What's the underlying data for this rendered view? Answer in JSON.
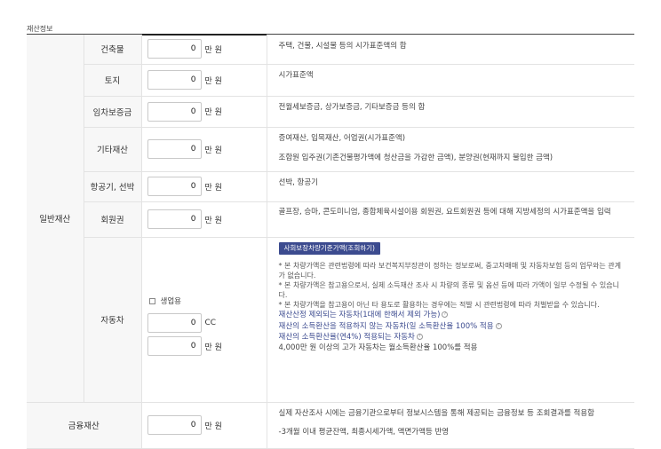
{
  "section_title": "재산정보",
  "category_general": "일반재산",
  "rows": [
    {
      "label": "건축물",
      "value": "0",
      "unit": "만 원",
      "desc": [
        "주택, 건물, 시설물 등의 시가표준액의 합"
      ]
    },
    {
      "label": "토지",
      "value": "0",
      "unit": "만 원",
      "desc": [
        "시가표준액"
      ]
    },
    {
      "label": "임차보증금",
      "value": "0",
      "unit": "만 원",
      "desc": [
        "전월세보증금, 상가보증금, 기타보증금 등의 합"
      ]
    },
    {
      "label": "기타재산",
      "value": "0",
      "unit": "만 원",
      "desc": [
        "증여재산, 입목재산, 어업권(시가표준액)",
        "조합원 입주권(기존건물평가액에 청산금을 가감한 금액), 분양권(현재까지 불입한 금액)"
      ]
    },
    {
      "label": "항공기, 선박",
      "value": "0",
      "unit": "만 원",
      "desc": [
        "선박, 항공기"
      ]
    },
    {
      "label": "회원권",
      "value": "0",
      "unit": "만 원",
      "desc": [
        "골프장, 승마, 콘도미니엄, 종합체육시설이용 회원권, 요트회원권 등에 대해 지방세정의 시가표준액을 입력"
      ]
    }
  ],
  "car": {
    "label": "자동차",
    "checkbox_label": "생업용",
    "cc_value": "0",
    "cc_unit": "CC",
    "price_value": "0",
    "price_unit": "만 원",
    "lookup_button": "사회보장차량기준가액(조회하기)",
    "notes": [
      "* 본 차량가액은 관련법령에 따라 보건복지부장관이 정하는 정보로써, 중고차매매 및 자동차보험 등의 업무와는 관계가 없습니다.",
      "* 본 차량가액은 참고용으로서, 실제 소득재산 조사 시 차량의 종류 및 옵션 등에 따라 가액이 일부 수정될 수 있습니다.",
      "* 본 차량가액을 참고용이 아닌 타 용도로 활용하는 경우에는 적발 시 관련법령에 따라 처벌받을 수 있습니다."
    ],
    "links": [
      "재산산정 제외되는 자동차(1대에 한해서 제외 가능)",
      "재산의 소득환산을 적용하지 않는 자동차(일 소득환산율 100% 적용",
      "재산의 소득환산율(연4%) 적용되는 자동차"
    ],
    "plain_note": "4,000만 원 이상의 고가 자동차는 월소득환산율 100%를 적용",
    "info_glyph": "?"
  },
  "finance": {
    "label": "금융재산",
    "value": "0",
    "unit": "만 원",
    "desc": [
      "실제 자산조사 시에는 금융기관으로부터 정보시스템을 통해 제공되는 금융정보 등 조회결과를 적용함",
      "-3개월 이내 평균잔액, 최종시세가액, 액면가액등 반영"
    ]
  }
}
